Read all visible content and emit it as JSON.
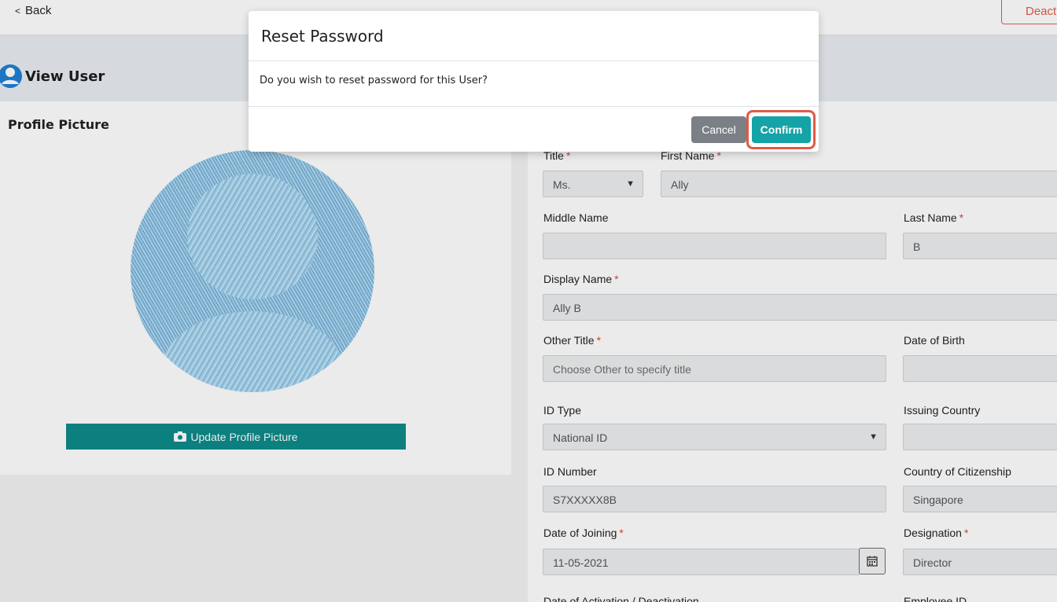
{
  "topbar": {
    "back_label": "Back",
    "deactivate_label": "Deacti"
  },
  "page": {
    "title": "View User"
  },
  "profile": {
    "label": "Profile Picture",
    "update_button": "Update Profile Picture"
  },
  "form": {
    "title_label": "Title",
    "title_value": "Ms.",
    "first_name_label": "First Name",
    "first_name_value": "Ally",
    "middle_name_label": "Middle Name",
    "middle_name_value": "",
    "last_name_label": "Last Name",
    "last_name_value": "B",
    "display_name_label": "Display Name",
    "display_name_value": "Ally B",
    "other_title_label": "Other Title",
    "other_title_placeholder": "Choose Other to specify title",
    "dob_label": "Date of Birth",
    "dob_value": "",
    "id_type_label": "ID Type",
    "id_type_value": "National ID",
    "issuing_country_label": "Issuing Country",
    "issuing_country_value": "",
    "id_number_label": "ID Number",
    "id_number_value": "S7XXXXX8B",
    "citizenship_label": "Country of Citizenship",
    "citizenship_value": "Singapore",
    "joining_label": "Date of Joining",
    "joining_value": "11-05-2021",
    "designation_label": "Designation",
    "designation_value": "Director",
    "activation_label": "Date of Activation / Deactivation",
    "employee_id_label": "Employee ID",
    "required_mark": "*"
  },
  "modal": {
    "title": "Reset Password",
    "message": "Do you wish to reset password for this User?",
    "cancel_label": "Cancel",
    "confirm_label": "Confirm"
  },
  "colors": {
    "accent": "#14a3a6",
    "danger": "#e35b4d",
    "update_button": "#0e8a8a"
  },
  "icons": [
    "chevron-left-icon",
    "user-circle-icon",
    "camera-icon",
    "calendar-icon",
    "chevron-down-icon"
  ]
}
